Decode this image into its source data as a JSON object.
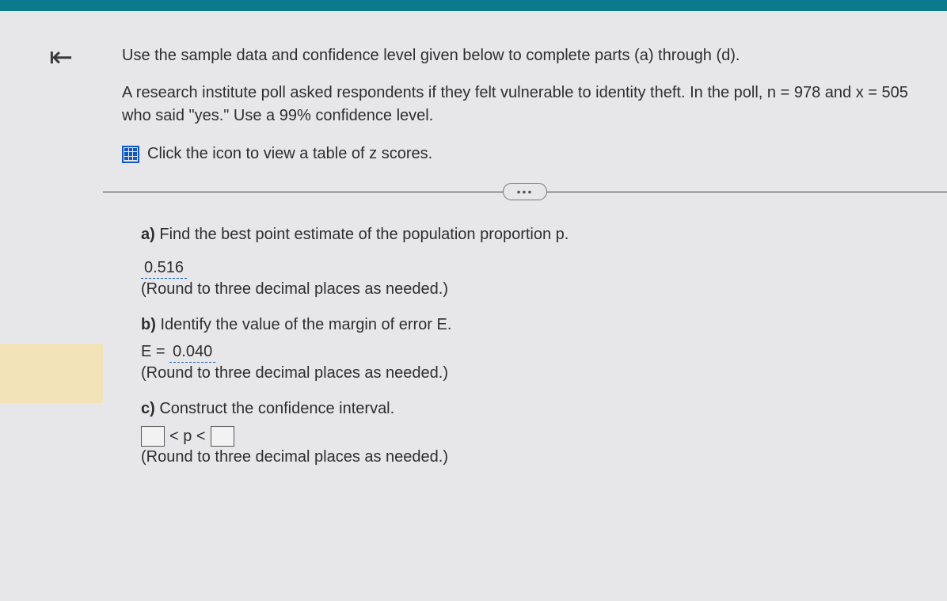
{
  "intro": "Use the sample data and confidence level given below to complete parts (a) through (d).",
  "description": "A research institute poll asked respondents if they felt vulnerable to identity theft. In the poll, n = 978 and x = 505 who said \"yes.\" Use a 99% confidence level.",
  "z_link": "Click the icon to view a table of z scores.",
  "ellipsis": "…",
  "parts": {
    "a": {
      "label": "a)",
      "text": "Find the best point estimate of the population proportion p.",
      "answer": "0.516",
      "hint": "(Round to three decimal places as needed.)"
    },
    "b": {
      "label": "b)",
      "text": "Identify the value of the margin of error E.",
      "eq_left": "E =",
      "answer": "0.040",
      "hint": "(Round to three decimal places as needed.)"
    },
    "c": {
      "label": "c)",
      "text": "Construct the confidence interval.",
      "ci_mid": "< p <",
      "hint": "(Round to three decimal places as needed.)"
    }
  }
}
